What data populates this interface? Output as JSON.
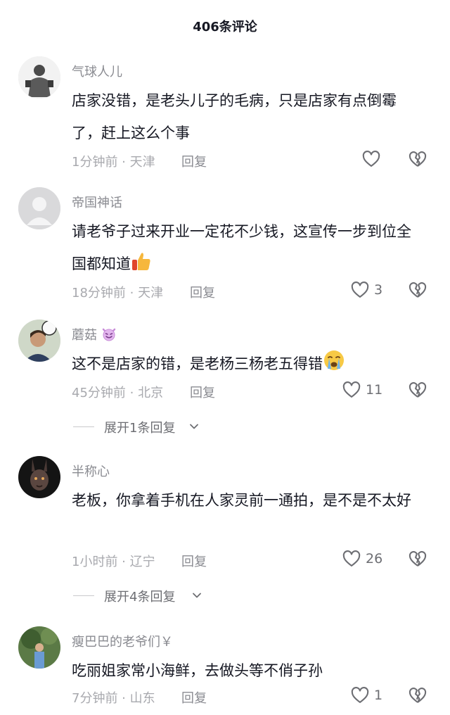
{
  "header": {
    "title": "406条评论"
  },
  "comments": [
    {
      "username": "气球人儿",
      "content": "店家没错，是老头儿子的毛病，只是店家有点倒霉了，赶上这么个事",
      "time": "1分钟前",
      "location": "天津",
      "reply_label": "回复",
      "likes": ""
    },
    {
      "username": "帝国神话",
      "content": "请老爷子过来开业一定花不少钱，这宣传一步到位全国都知道",
      "emoji": "thumbs-up",
      "time": "18分钟前",
      "location": "天津",
      "reply_label": "回复",
      "likes": "3"
    },
    {
      "username": "蘑菇",
      "username_emoji": "devil-face",
      "content": "这不是店家的错，是老杨三杨老五得错",
      "emoji": "crying-face",
      "time": "45分钟前",
      "location": "北京",
      "reply_label": "回复",
      "likes": "11",
      "expand_label": "展开1条回复"
    },
    {
      "username": "半称心",
      "content": "老板，你拿着手机在人家灵前一通拍，是不是不太好",
      "time": "1小时前",
      "location": "辽宁",
      "reply_label": "回复",
      "likes": "26",
      "expand_label": "展开4条回复"
    },
    {
      "username": "瘦巴巴的老爷们￥",
      "content": "吃丽姐家常小海鲜，去做头等不俏子孙",
      "time": "7分钟前",
      "location": "山东",
      "reply_label": "回复",
      "likes": "1"
    }
  ],
  "separator": " · ",
  "icons": {
    "like": "heart-outline-icon",
    "dislike": "broken-heart-icon",
    "expand": "chevron-down-icon"
  },
  "colors": {
    "text": "#161823",
    "muted": "#8a8b91",
    "icon": "#6d6e73"
  }
}
